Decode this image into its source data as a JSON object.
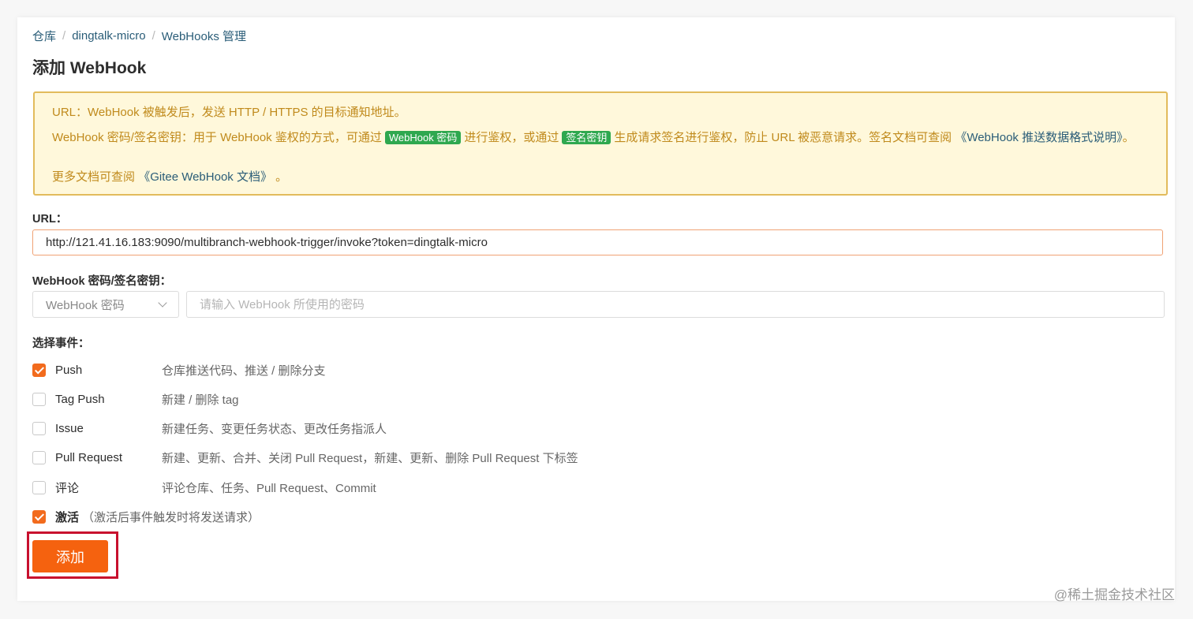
{
  "breadcrumb": {
    "items": [
      "仓库",
      "dingtalk-micro",
      "WebHooks 管理"
    ],
    "separator": "/"
  },
  "page_title": "添加 WebHook",
  "notice": {
    "line1": "URL：WebHook 被触发后，发送 HTTP / HTTPS 的目标通知地址。",
    "line2_a": "WebHook 密码/签名密钥：用于 WebHook 鉴权的方式，可通过",
    "tag1": "WebHook 密码",
    "line2_b": "进行鉴权，或通过",
    "tag2": "签名密钥",
    "line2_c": "生成请求签名进行鉴权，防止 URL 被恶意请求。签名文档可查阅",
    "line2_link": "《WebHook 推送数据格式说明》",
    "line2_end": "。",
    "line3_a": "更多文档可查阅",
    "line3_link": "《Gitee WebHook 文档》",
    "line3_end": "。"
  },
  "url": {
    "label": "URL：",
    "value": "http://121.41.16.183:9090/multibranch-webhook-trigger/invoke?token=dingtalk-micro"
  },
  "secret": {
    "label": "WebHook 密码/签名密钥：",
    "type_selected": "WebHook 密码",
    "placeholder": "请输入 WebHook 所使用的密码"
  },
  "events": {
    "label": "选择事件：",
    "items": [
      {
        "name": "Push",
        "desc": "仓库推送代码、推送 / 删除分支",
        "checked": true
      },
      {
        "name": "Tag Push",
        "desc": "新建 / 删除 tag",
        "checked": false
      },
      {
        "name": "Issue",
        "desc": "新建任务、变更任务状态、更改任务指派人",
        "checked": false
      },
      {
        "name": "Pull Request",
        "desc": "新建、更新、合并、关闭 Pull Request，新建、更新、删除 Pull Request 下标签",
        "checked": false
      },
      {
        "name": "评论",
        "desc": "评论仓库、任务、Pull Request、Commit",
        "checked": false
      }
    ]
  },
  "activate": {
    "label": "激活",
    "note": "（激活后事件触发时将发送请求）",
    "checked": true
  },
  "submit_label": "添加",
  "watermark": "@稀土掘金技术社区",
  "colors": {
    "accent": "#f5620f",
    "link": "#2a5d78",
    "notice_bg": "#fff8db",
    "notice_text": "#c08a1c",
    "tag_green": "#2fa84f",
    "highlight": "#c8102e"
  }
}
